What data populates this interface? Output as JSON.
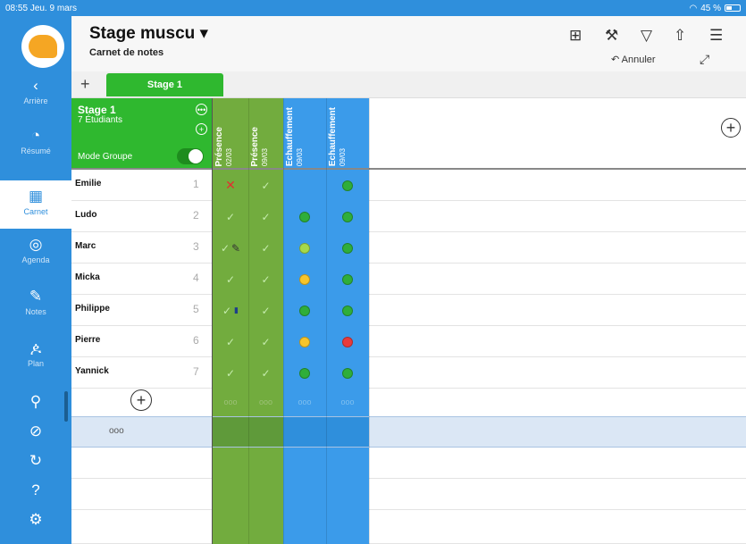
{
  "statusbar": {
    "time": "08:55",
    "date": "Jeu. 9 mars",
    "battery": "45 %",
    "wifi_icon": "wifi-icon"
  },
  "sidebar": {
    "items": [
      {
        "label": "Arrière",
        "icon": "chevron-left-icon",
        "glyph": "‹"
      },
      {
        "label": "Résumé",
        "icon": "pie-chart-icon",
        "glyph": "◔"
      },
      {
        "label": "Carnet",
        "icon": "grid-icon",
        "glyph": "▦"
      },
      {
        "label": "Agenda",
        "icon": "clock-icon",
        "glyph": "◎"
      },
      {
        "label": "Notes",
        "icon": "pencil-icon",
        "glyph": "✎"
      },
      {
        "label": "Plan",
        "icon": "people-icon",
        "glyph": "ዾ"
      }
    ],
    "bottom_icons": [
      "pin-icon",
      "check-circle-icon",
      "sync-icon",
      "help-icon",
      "settings-icon"
    ]
  },
  "header": {
    "title": "Stage muscu ▾",
    "subtitle": "Carnet de notes",
    "undo_label": "Annuler"
  },
  "tabs": {
    "add": "+",
    "active": "Stage 1"
  },
  "group": {
    "name": "Stage 1",
    "count": "7 Étudiants",
    "mode_label": "Mode Groupe"
  },
  "columns": [
    {
      "label": "Présence",
      "date": "02/03",
      "color": "#72ac3e"
    },
    {
      "label": "Présence",
      "date": "09/03",
      "color": "#72ac3e"
    },
    {
      "label": "Echauffement",
      "date": "09/03",
      "color": "#3b9bea"
    },
    {
      "label": "Echauffement",
      "date": "09/03",
      "color": "#3b9bea"
    }
  ],
  "students": [
    {
      "name": "Emilie",
      "num": "1",
      "marks": [
        "cross",
        "check",
        "empty",
        "green"
      ]
    },
    {
      "name": "Ludo",
      "num": "2",
      "marks": [
        "check",
        "check",
        "green",
        "green"
      ]
    },
    {
      "name": "Marc",
      "num": "3",
      "marks": [
        "check-pencil",
        "check",
        "lightgreen",
        "green"
      ]
    },
    {
      "name": "Micka",
      "num": "4",
      "marks": [
        "check",
        "check",
        "yellow",
        "green"
      ]
    },
    {
      "name": "Philippe",
      "num": "5",
      "marks": [
        "check-bottle",
        "check",
        "green",
        "green"
      ]
    },
    {
      "name": "Pierre",
      "num": "6",
      "marks": [
        "check",
        "check",
        "yellow",
        "red"
      ]
    },
    {
      "name": "Yannick",
      "num": "7",
      "marks": [
        "check",
        "check",
        "green",
        "green"
      ]
    }
  ],
  "add_row": {
    "dots": "ooo"
  },
  "selected_row": {
    "dots": "ooo"
  }
}
